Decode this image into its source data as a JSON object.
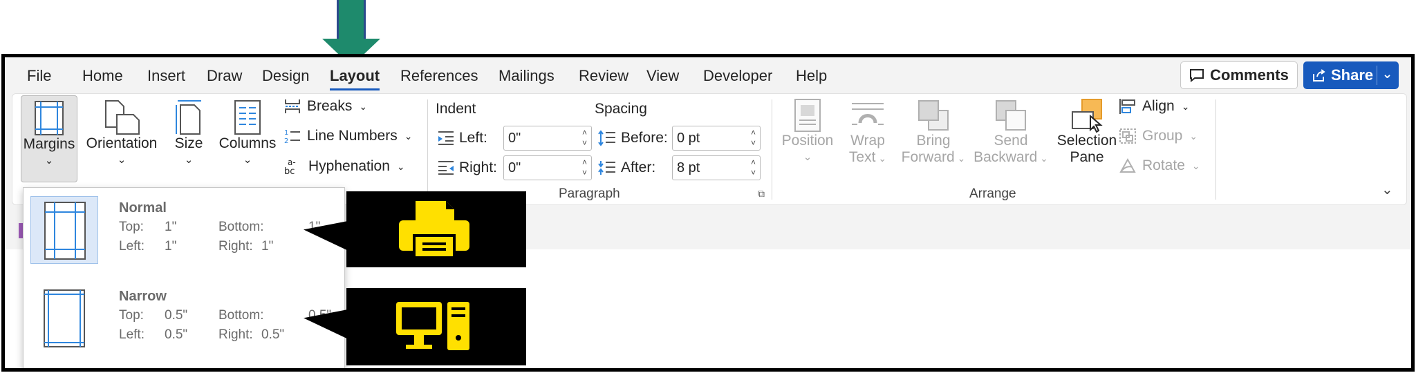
{
  "menu": {
    "items": [
      "File",
      "Home",
      "Insert",
      "Draw",
      "Design",
      "Layout",
      "References",
      "Mailings",
      "Review",
      "View",
      "Developer",
      "Help"
    ],
    "active": "Layout",
    "comments_label": "Comments",
    "share_label": "Share"
  },
  "ribbon": {
    "page_setup": {
      "margins": "Margins",
      "orientation": "Orientation",
      "size": "Size",
      "columns": "Columns",
      "breaks": "Breaks",
      "line_numbers": "Line Numbers",
      "hyphenation": "Hyphenation"
    },
    "paragraph": {
      "group_label": "Paragraph",
      "indent_header": "Indent",
      "spacing_header": "Spacing",
      "left_label": "Left:",
      "left_value": "0\"",
      "right_label": "Right:",
      "right_value": "0\"",
      "before_label": "Before:",
      "before_value": "0 pt",
      "after_label": "After:",
      "after_value": "8 pt"
    },
    "arrange": {
      "group_label": "Arrange",
      "position": "Position",
      "wrap_1": "Wrap",
      "wrap_2": "Text",
      "bring_1": "Bring",
      "bring_2": "Forward",
      "send_1": "Send",
      "send_2": "Backward",
      "selection_1": "Selection",
      "selection_2": "Pane",
      "align": "Align",
      "group": "Group",
      "rotate": "Rotate"
    }
  },
  "margins_dropdown": {
    "normal": {
      "title": "Normal",
      "top_label": "Top:",
      "top_value": "1\"",
      "bottom_label": "Bottom:",
      "bottom_value": "1\"",
      "left_label": "Left:",
      "left_value": "1\"",
      "right_label": "Right:",
      "right_value": "1\""
    },
    "narrow": {
      "title": "Narrow",
      "top_label": "Top:",
      "top_value": "0.5\"",
      "bottom_label": "Bottom:",
      "bottom_value": "0.5\"",
      "left_label": "Left:",
      "left_value": "0.5\"",
      "right_label": "Right:",
      "right_value": "0.5\""
    }
  },
  "callouts": [
    {
      "icon": "printer-icon",
      "color": "#ffe000"
    },
    {
      "icon": "desktop-computer-icon",
      "color": "#ffe000"
    }
  ],
  "colors": {
    "accent": "#185abd",
    "arrow": "#1e8a6c",
    "callout_bg": "#000000",
    "callout_icon": "#ffe000"
  }
}
